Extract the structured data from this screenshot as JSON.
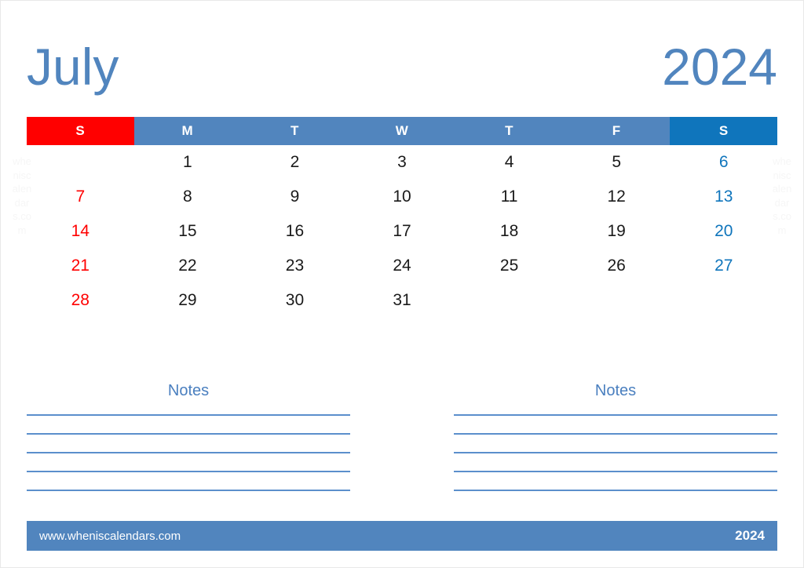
{
  "page": {
    "month": "July",
    "year": "2024",
    "border_color": "#e8e8e8",
    "background": "#ffffff"
  },
  "colors": {
    "accent_blue": "#5185be",
    "saturday_blue": "#0f75bc",
    "sunday_red": "#ff0000",
    "weekday_text": "#1a1a1a",
    "notes_rule": "#5b8fcc",
    "notes_title": "#4a7fbf",
    "watermark": "#f6f6f6"
  },
  "weekdays": [
    {
      "label": "S",
      "kind": "sun"
    },
    {
      "label": "M",
      "kind": "weekday"
    },
    {
      "label": "T",
      "kind": "weekday"
    },
    {
      "label": "W",
      "kind": "weekday"
    },
    {
      "label": "T",
      "kind": "weekday"
    },
    {
      "label": "F",
      "kind": "weekday"
    },
    {
      "label": "S",
      "kind": "sat"
    }
  ],
  "weeks": [
    [
      "",
      "1",
      "2",
      "3",
      "4",
      "5",
      "6"
    ],
    [
      "7",
      "8",
      "9",
      "10",
      "11",
      "12",
      "13"
    ],
    [
      "14",
      "15",
      "16",
      "17",
      "18",
      "19",
      "20"
    ],
    [
      "21",
      "22",
      "23",
      "24",
      "25",
      "26",
      "27"
    ],
    [
      "28",
      "29",
      "30",
      "31",
      "",
      "",
      ""
    ]
  ],
  "notes": {
    "left": {
      "title": "Notes",
      "line_count": 5
    },
    "right": {
      "title": "Notes",
      "line_count": 5
    }
  },
  "footer": {
    "url": "www.wheniscalendars.com",
    "year": "2024"
  },
  "watermark": {
    "text": "wheniscalendars.com"
  }
}
